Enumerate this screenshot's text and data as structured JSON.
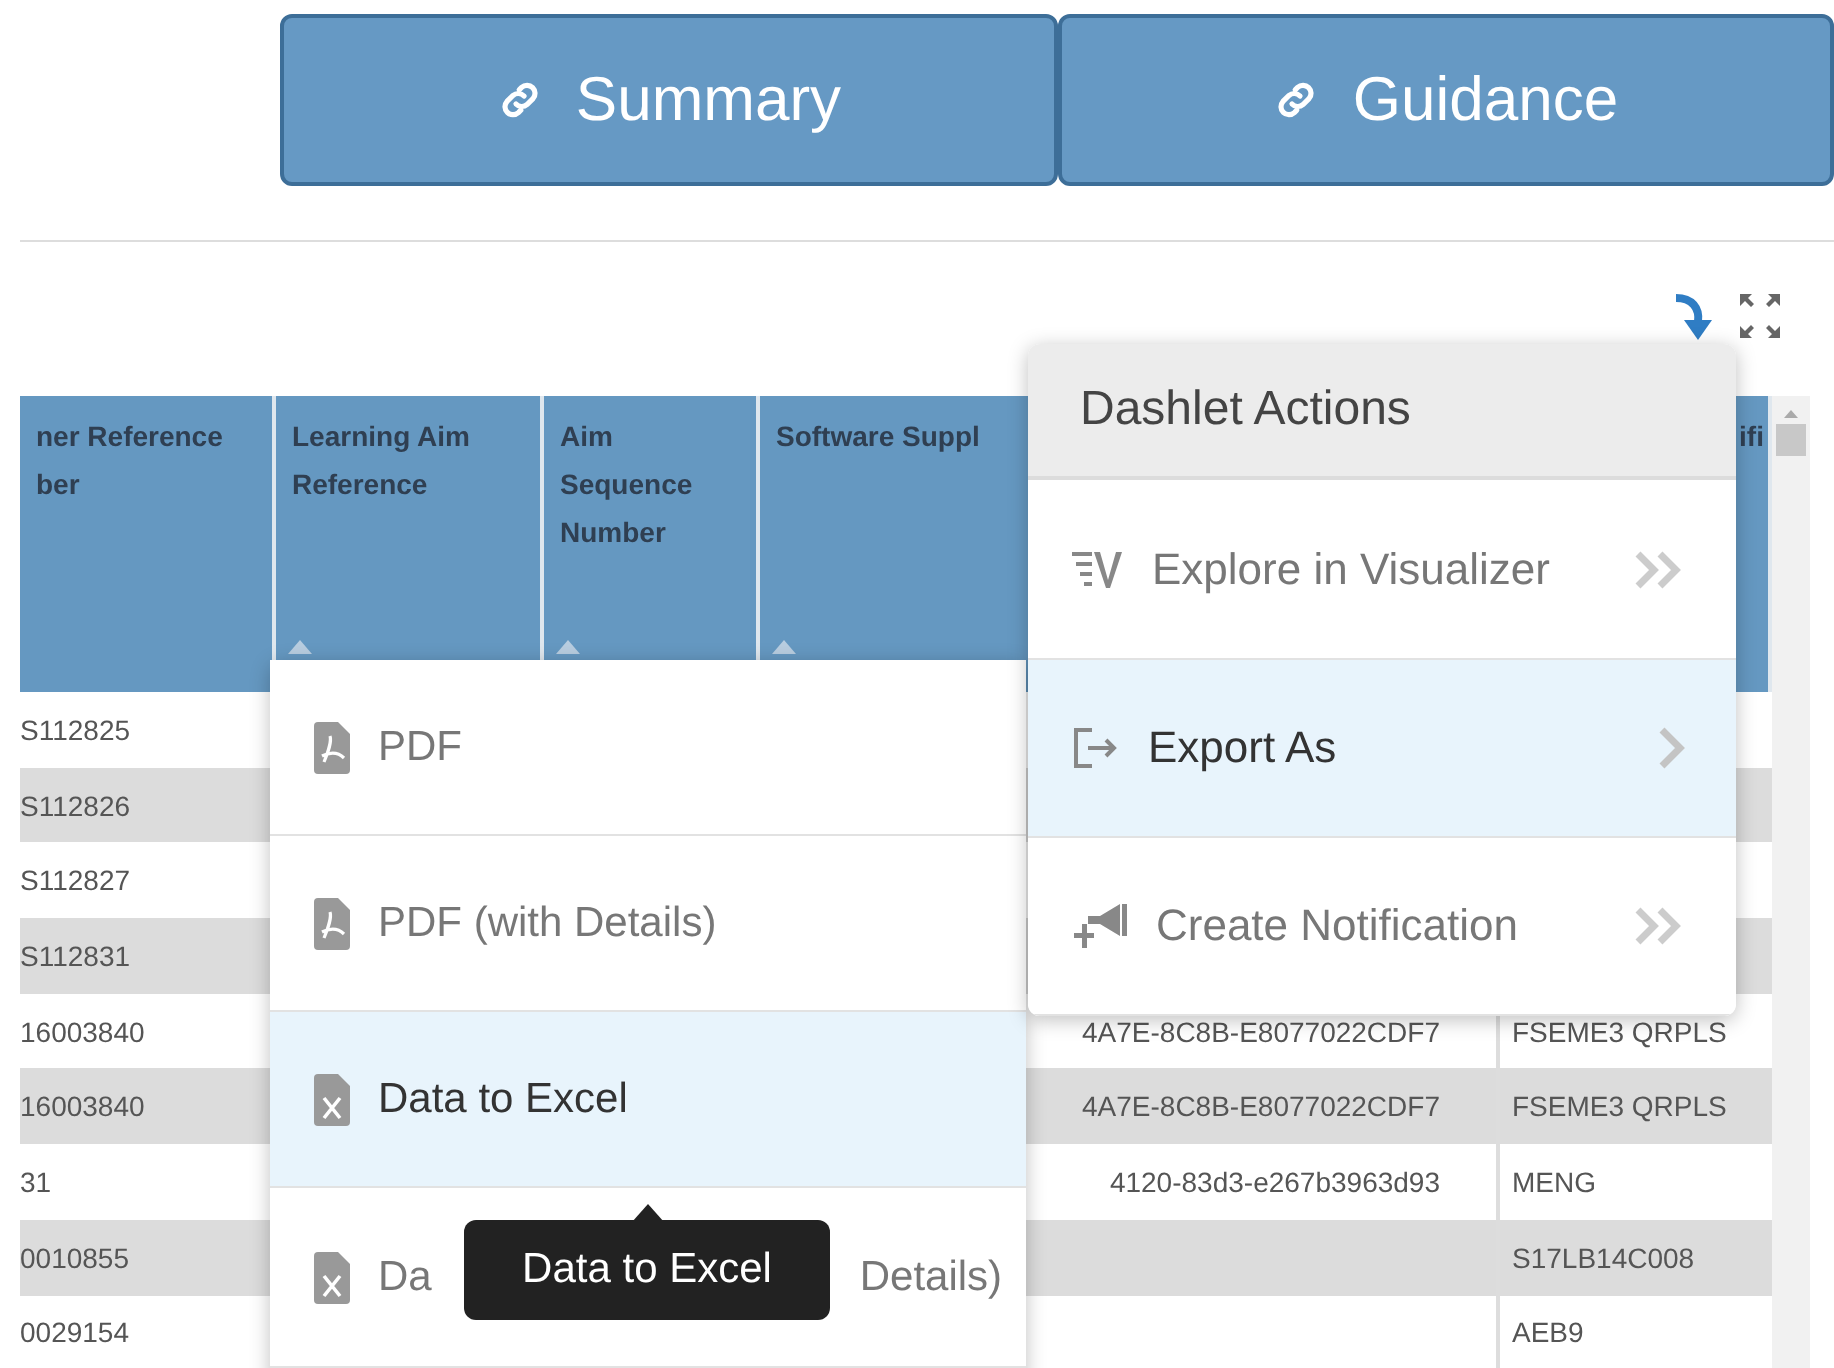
{
  "tabs": [
    {
      "label": "Summary",
      "selected": false
    },
    {
      "label": "Guidance",
      "selected": false
    }
  ],
  "table": {
    "columns": [
      {
        "label": "ner Reference ber",
        "sortable": false
      },
      {
        "label": "Learning Aim Reference",
        "sortable": true
      },
      {
        "label": "Aim Sequence Number",
        "sortable": true
      },
      {
        "label": "Software Suppl",
        "sortable": true
      },
      {
        "label": "ifi"
      }
    ],
    "rows": [
      [
        "S112825",
        "",
        "",
        "",
        ""
      ],
      [
        "S112826",
        "",
        "",
        "",
        ""
      ],
      [
        "S112827",
        "",
        "",
        "",
        ""
      ],
      [
        "S112831",
        "",
        "",
        "",
        ""
      ],
      [
        "16003840",
        "",
        "",
        "4A7E-8C8B-E8077022CDF7",
        "FSEME3 QRPLS"
      ],
      [
        "16003840",
        "",
        "",
        "4A7E-8C8B-E8077022CDF7",
        "FSEME3 QRPLS"
      ],
      [
        "31",
        "",
        "",
        "4120-83d3-e267b3963d93",
        "MENG"
      ],
      [
        "0010855",
        "",
        "",
        "",
        "S17LB14C008"
      ],
      [
        "0029154",
        "",
        "",
        "",
        "AEB9"
      ]
    ]
  },
  "dashlet_menu": {
    "title": "Dashlet Actions",
    "items": [
      {
        "label": "Explore in Visualizer",
        "kind": "action",
        "selected": false
      },
      {
        "label": "Export As",
        "kind": "submenu",
        "selected": true
      },
      {
        "label": "Create Notification",
        "kind": "action",
        "selected": false
      }
    ]
  },
  "export_menu": {
    "items": [
      {
        "label_parts": [
          "PDF"
        ],
        "kind": "pdf",
        "selected": false
      },
      {
        "label_parts": [
          "PDF (with Details)"
        ],
        "kind": "pdf",
        "selected": false
      },
      {
        "label_parts": [
          "Data to Excel"
        ],
        "kind": "excel",
        "selected": true
      },
      {
        "label_parts": [
          "Da",
          "Details)"
        ],
        "kind": "excel",
        "selected": false
      }
    ]
  },
  "tooltip": "Data to Excel"
}
